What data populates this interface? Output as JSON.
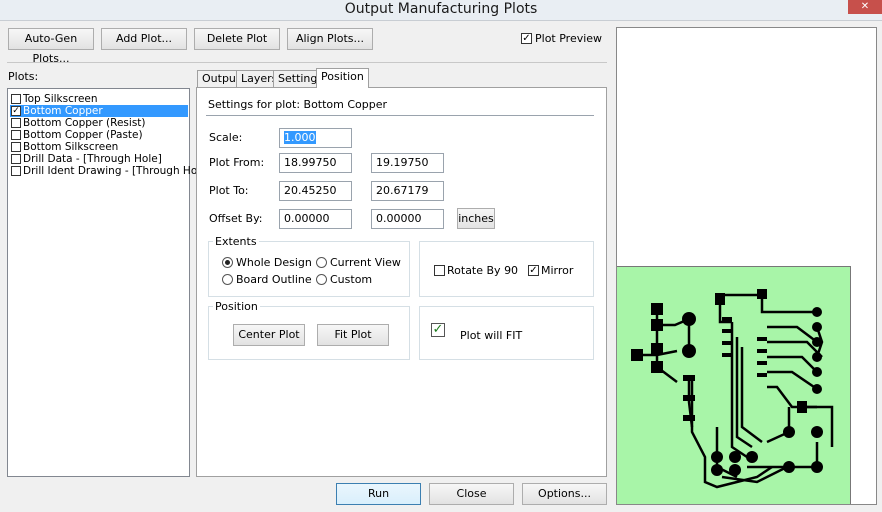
{
  "window": {
    "title": "Output Manufacturing Plots",
    "close_glyph": "✕"
  },
  "toolbar": {
    "auto_gen": "Auto-Gen Plots...",
    "add_plot": "Add Plot...",
    "delete_plot": "Delete Plot",
    "align_plots": "Align Plots...",
    "plot_preview_label": "Plot Preview",
    "plot_preview_checked": true
  },
  "plots": {
    "label": "Plots:",
    "items": [
      {
        "label": "Top Silkscreen",
        "checked": false,
        "selected": false
      },
      {
        "label": "Bottom Copper",
        "checked": true,
        "selected": true
      },
      {
        "label": "Bottom Copper (Resist)",
        "checked": false,
        "selected": false
      },
      {
        "label": "Bottom Copper (Paste)",
        "checked": false,
        "selected": false
      },
      {
        "label": "Bottom Silkscreen",
        "checked": false,
        "selected": false
      },
      {
        "label": "Drill Data - [Through Hole]",
        "checked": false,
        "selected": false
      },
      {
        "label": "Drill Ident Drawing - [Through Hole]",
        "checked": false,
        "selected": false
      }
    ]
  },
  "tabs": [
    {
      "label": "Output",
      "active": false
    },
    {
      "label": "Layers",
      "active": false
    },
    {
      "label": "Settings",
      "active": false
    },
    {
      "label": "Position",
      "active": true
    }
  ],
  "position": {
    "heading": "Settings for plot: Bottom Copper",
    "scale_label": "Scale:",
    "scale_value": "1.000",
    "plot_from_label": "Plot From:",
    "plot_from_x": "18.99750",
    "plot_from_y": "19.19750",
    "plot_to_label": "Plot To:",
    "plot_to_x": "20.45250",
    "plot_to_y": "20.67179",
    "offset_label": "Offset By:",
    "offset_x": "0.00000",
    "offset_y": "0.00000",
    "units_button": "inches",
    "extents": {
      "title": "Extents",
      "whole_design": "Whole Design",
      "current_view": "Current View",
      "board_outline": "Board Outline",
      "custom": "Custom",
      "selected": "Whole Design"
    },
    "rotate_label": "Rotate By 90",
    "rotate_checked": false,
    "mirror_label": "Mirror",
    "mirror_checked": true,
    "position_group": {
      "title": "Position",
      "center_plot": "Center Plot",
      "fit_plot": "Fit Plot"
    },
    "fit_status": "Plot will  FIT",
    "fit_check_glyph": "✓"
  },
  "footer": {
    "run": "Run",
    "close": "Close",
    "options": "Options..."
  },
  "colors": {
    "board": "#a8f5a8",
    "selection": "#3399ff",
    "traces": "#000000"
  }
}
